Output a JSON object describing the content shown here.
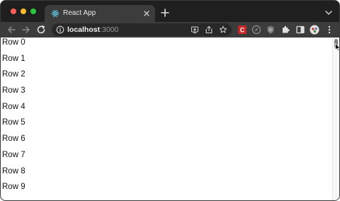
{
  "browser": {
    "tab": {
      "title": "React App",
      "icon": "react-logo-icon"
    },
    "toolbar": {
      "url_host": "localhost",
      "url_port": ":3000"
    },
    "colors": {
      "tab_strip": "#1f1f1f",
      "toolbar": "#3c3c3c",
      "omnibox": "#282828",
      "react_blue": "#61dafb"
    }
  },
  "page": {
    "rows": [
      "Row 0",
      "Row 1",
      "Row 2",
      "Row 3",
      "Row 4",
      "Row 5",
      "Row 6",
      "Row 7",
      "Row 8",
      "Row 9"
    ]
  }
}
